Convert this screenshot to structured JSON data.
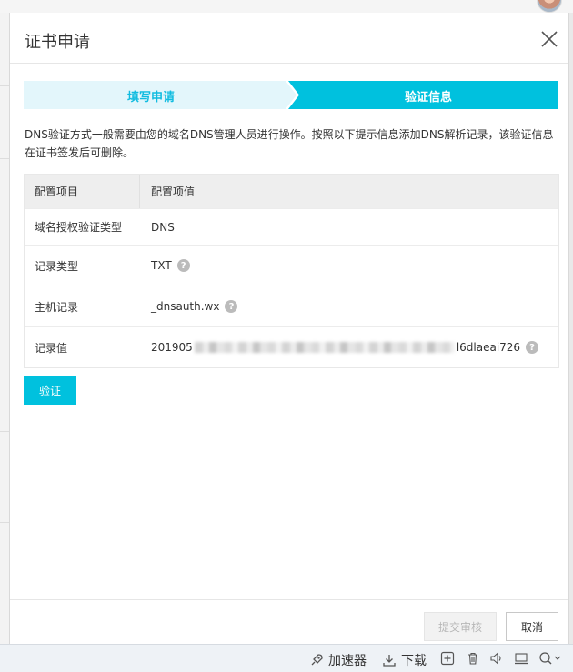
{
  "dialog": {
    "title": "证书申请"
  },
  "steps": [
    {
      "label": "填写申请",
      "state": "done"
    },
    {
      "label": "验证信息",
      "state": "active"
    }
  ],
  "description": "DNS验证方式一般需要由您的域名DNS管理人员进行操作。按照以下提示信息添加DNS解析记录，该验证信息在证书签发后可删除。",
  "table": {
    "headers": [
      "配置项目",
      "配置项值"
    ],
    "rows": [
      {
        "item": "域名授权验证类型",
        "value": "DNS"
      },
      {
        "item": "记录类型",
        "value": "TXT"
      },
      {
        "item": "主机记录",
        "value": "_dnsauth.wx"
      },
      {
        "item": "记录值",
        "value_prefix": "201905",
        "value_suffix": "l6dlaeai726"
      }
    ]
  },
  "help_glyph": "?",
  "buttons": {
    "verify": "验证",
    "submit": "提交审核",
    "cancel": "取消"
  },
  "statusbar": {
    "accelerator": "加速器",
    "download": "下载"
  },
  "colors": {
    "accent": "#00c1de",
    "step_done_bg": "#e3f6fb",
    "step_done_text": "#11bce0",
    "help_icon": "#bbbbbb"
  }
}
